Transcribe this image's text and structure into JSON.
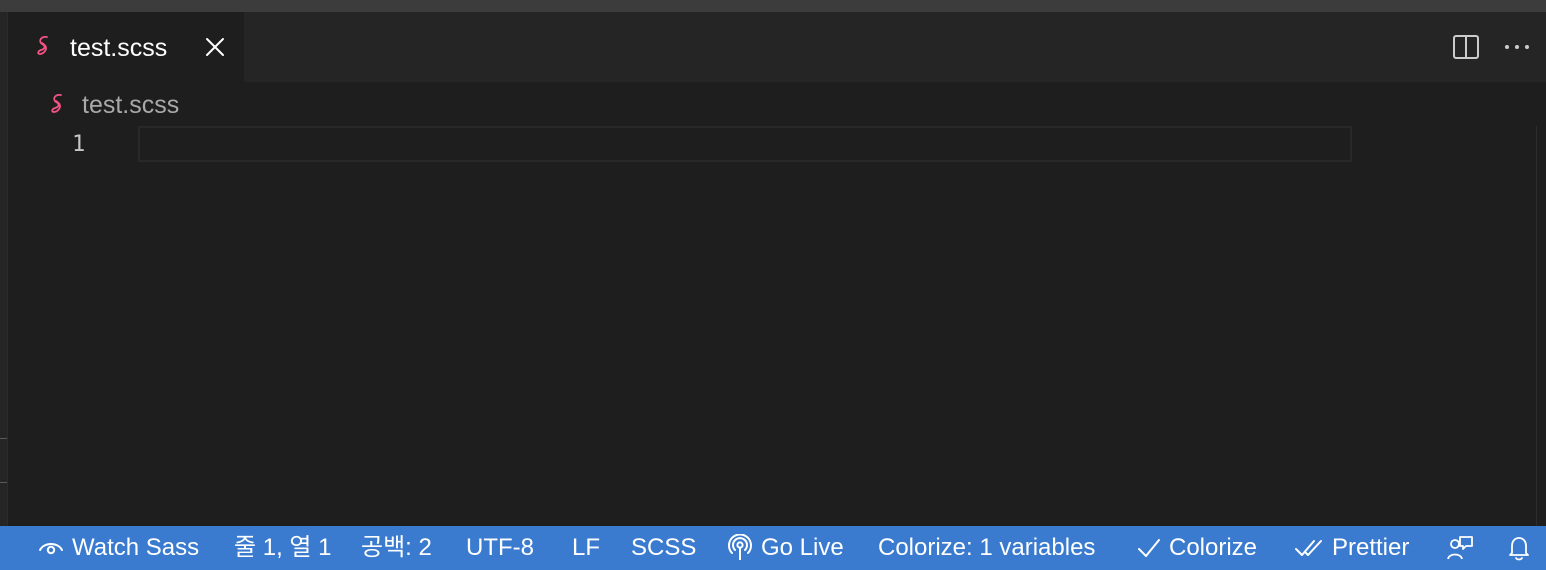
{
  "editor": {
    "tab": {
      "label": "test.scss",
      "icon": "sass-icon"
    },
    "breadcrumb": {
      "label": "test.scss",
      "icon": "sass-icon"
    },
    "line_numbers": [
      "1"
    ],
    "actions": {
      "split": "split-editor-icon",
      "more": "more-actions-icon"
    }
  },
  "statusbar": {
    "watch_sass": "Watch Sass",
    "cursor_position": "줄 1, 열 1",
    "indentation": "공백: 2",
    "encoding": "UTF-8",
    "eol": "LF",
    "language": "SCSS",
    "go_live": "Go Live",
    "colorize_vars": "Colorize: 1 variables",
    "colorize": "Colorize",
    "prettier": "Prettier"
  },
  "colors": {
    "accent_statusbar": "#3a7bd0",
    "sass_icon": "#f55385",
    "editor_bg": "#1e1e1e"
  }
}
